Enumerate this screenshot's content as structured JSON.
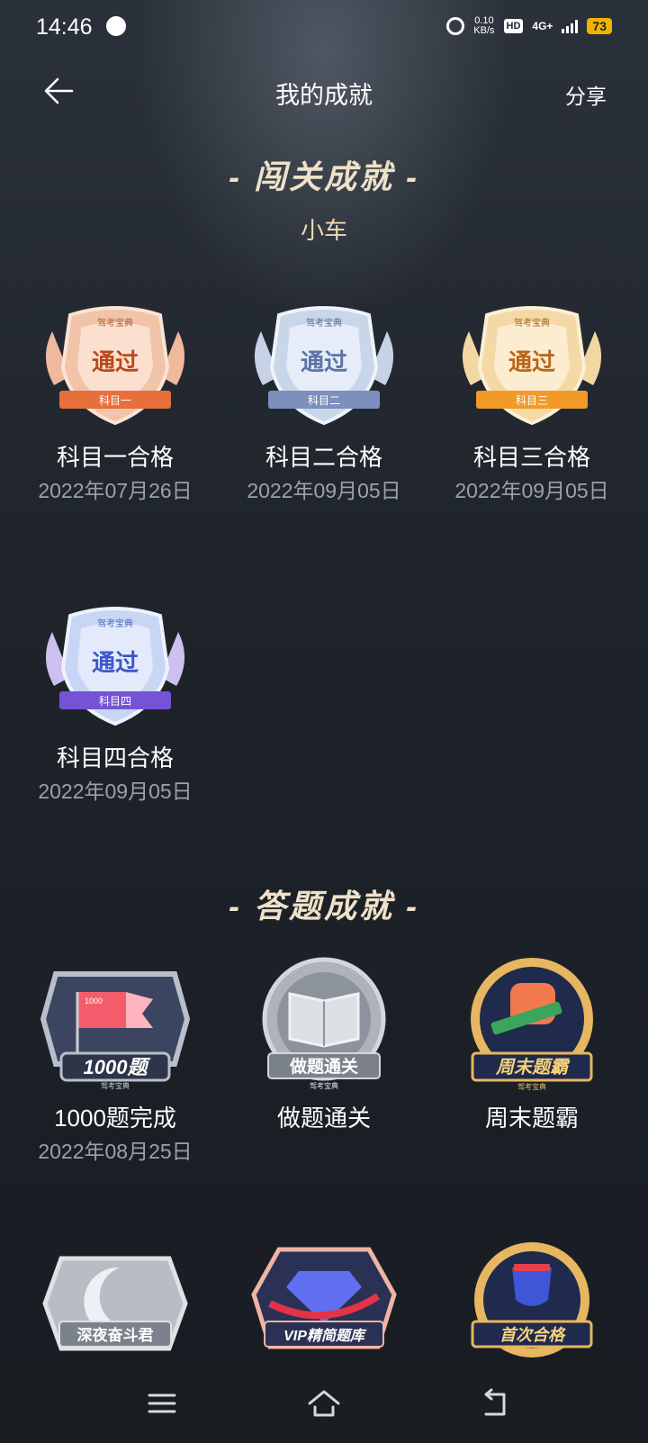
{
  "status": {
    "time": "14:46",
    "speed_top": "0.10",
    "speed_bottom": "KB/s",
    "hd": "HD",
    "network": "4G+",
    "battery": "73"
  },
  "header": {
    "title": "我的成就",
    "share": "分享"
  },
  "sections": {
    "pass": {
      "title": "- 闯关成就 -",
      "subtitle": "小车"
    },
    "answer": {
      "title": "- 答题成就 -"
    }
  },
  "pass_badges": [
    {
      "name": "科目一合格",
      "date": "2022年07月26日",
      "badge_text": "通过",
      "ribbon": "科目一",
      "logo": "驾考宝典",
      "color": "#e98a62"
    },
    {
      "name": "科目二合格",
      "date": "2022年09月05日",
      "badge_text": "通过",
      "ribbon": "科目二",
      "logo": "驾考宝典",
      "color": "#8fa3c7"
    },
    {
      "name": "科目三合格",
      "date": "2022年09月05日",
      "badge_text": "通过",
      "ribbon": "科目三",
      "logo": "驾考宝典",
      "color": "#f0a536"
    },
    {
      "name": "科目四合格",
      "date": "2022年09月05日",
      "badge_text": "通过",
      "ribbon": "科目四",
      "logo": "驾考宝典",
      "color": "#7f63d8"
    }
  ],
  "answer_badges": [
    {
      "name": "1000题完成",
      "date": "2022年08月25日",
      "badge_text": "1000题",
      "logo": "驾考宝典",
      "flag_text": "1000"
    },
    {
      "name": "做题通关",
      "date": "",
      "badge_text": "做题通关",
      "logo": "驾考宝典"
    },
    {
      "name": "周末题霸",
      "date": "",
      "badge_text": "周末题霸",
      "logo": "驾考宝典"
    },
    {
      "name": "",
      "date": "",
      "badge_text": "深夜奋斗君"
    },
    {
      "name": "",
      "date": "",
      "badge_text": "VIP精简题库"
    },
    {
      "name": "",
      "date": "",
      "badge_text": "首次合格"
    }
  ]
}
